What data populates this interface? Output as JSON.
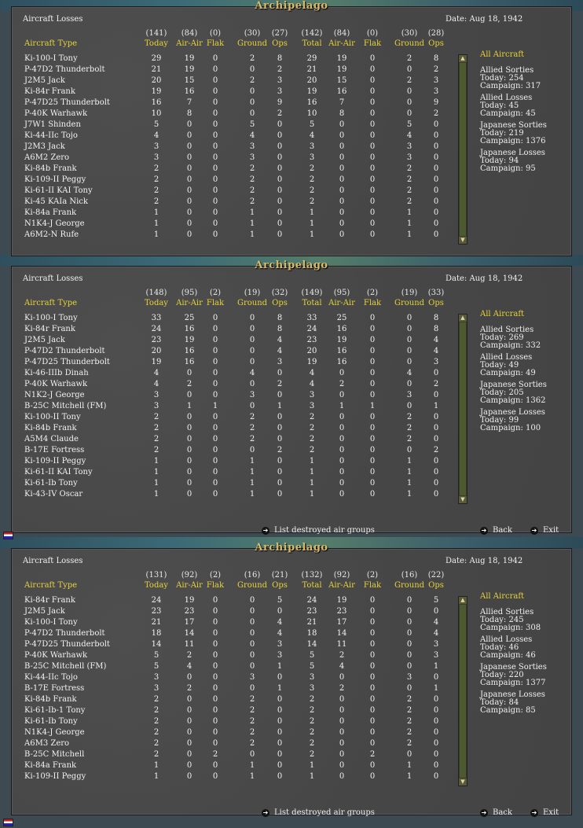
{
  "panels": [
    {
      "title": "Archipelago",
      "header": {
        "title": "Aircraft Losses",
        "date": "Date: Aug 18, 1942",
        "type_label": "Aircraft Type"
      },
      "totals": [
        "(141)",
        "(84)",
        "(0)",
        "(30)",
        "(27)",
        "(142)",
        "(84)",
        "(0)",
        "(30)",
        "(28)"
      ],
      "col_names": [
        "Today",
        "Air-Air",
        "Flak",
        "Ground",
        "Ops",
        "Total",
        "Air-Air",
        "Flak",
        "Ground",
        "Ops"
      ],
      "rows": [
        {
          "name": "Ki-100-I Tony",
          "v": [
            "29",
            "19",
            "0",
            "2",
            "8",
            "29",
            "19",
            "0",
            "2",
            "8"
          ]
        },
        {
          "name": "P-47D2 Thunderbolt",
          "v": [
            "21",
            "19",
            "0",
            "0",
            "2",
            "21",
            "19",
            "0",
            "0",
            "2"
          ]
        },
        {
          "name": "J2M5 Jack",
          "v": [
            "20",
            "15",
            "0",
            "2",
            "3",
            "20",
            "15",
            "0",
            "2",
            "3"
          ]
        },
        {
          "name": "Ki-84r Frank",
          "v": [
            "19",
            "16",
            "0",
            "0",
            "3",
            "19",
            "16",
            "0",
            "0",
            "3"
          ]
        },
        {
          "name": "P-47D25 Thunderbolt",
          "v": [
            "16",
            "7",
            "0",
            "0",
            "9",
            "16",
            "7",
            "0",
            "0",
            "9"
          ]
        },
        {
          "name": "P-40K Warhawk",
          "v": [
            "10",
            "8",
            "0",
            "0",
            "2",
            "10",
            "8",
            "0",
            "0",
            "2"
          ]
        },
        {
          "name": "J7W1 Shinden",
          "v": [
            "5",
            "0",
            "0",
            "5",
            "0",
            "5",
            "0",
            "0",
            "5",
            "0"
          ]
        },
        {
          "name": "Ki-44-IIc Tojo",
          "v": [
            "4",
            "0",
            "0",
            "4",
            "0",
            "4",
            "0",
            "0",
            "4",
            "0"
          ]
        },
        {
          "name": "J2M3 Jack",
          "v": [
            "3",
            "0",
            "0",
            "3",
            "0",
            "3",
            "0",
            "0",
            "3",
            "0"
          ]
        },
        {
          "name": "A6M2 Zero",
          "v": [
            "3",
            "0",
            "0",
            "3",
            "0",
            "3",
            "0",
            "0",
            "3",
            "0"
          ]
        },
        {
          "name": "Ki-84b Frank",
          "v": [
            "2",
            "0",
            "0",
            "2",
            "0",
            "2",
            "0",
            "0",
            "2",
            "0"
          ]
        },
        {
          "name": "Ki-109-II Peggy",
          "v": [
            "2",
            "0",
            "0",
            "2",
            "0",
            "2",
            "0",
            "0",
            "2",
            "0"
          ]
        },
        {
          "name": "Ki-61-II KAI Tony",
          "v": [
            "2",
            "0",
            "0",
            "2",
            "0",
            "2",
            "0",
            "0",
            "2",
            "0"
          ]
        },
        {
          "name": "Ki-45 KAIa Nick",
          "v": [
            "2",
            "0",
            "0",
            "2",
            "0",
            "2",
            "0",
            "0",
            "2",
            "0"
          ]
        },
        {
          "name": "Ki-84a Frank",
          "v": [
            "1",
            "0",
            "0",
            "1",
            "0",
            "1",
            "0",
            "0",
            "1",
            "0"
          ]
        },
        {
          "name": "N1K4-J George",
          "v": [
            "1",
            "0",
            "0",
            "1",
            "0",
            "1",
            "0",
            "0",
            "1",
            "0"
          ]
        },
        {
          "name": "A6M2-N Rufe",
          "v": [
            "1",
            "0",
            "0",
            "1",
            "0",
            "1",
            "0",
            "0",
            "1",
            "0"
          ]
        }
      ],
      "side": {
        "all": "All Aircraft",
        "allied_sorties": {
          "label": "Allied Sorties",
          "today": "Today:   254",
          "campaign": "Campaign: 317"
        },
        "allied_losses": {
          "label": "Allied Losses",
          "today": "Today:   45",
          "campaign": "Campaign: 45"
        },
        "japanese_sorties": {
          "label": "Japanese Sorties",
          "today": "Today:   219",
          "campaign": "Campaign: 1376"
        },
        "japanese_losses": {
          "label": "Japanese Losses",
          "today": "Today:   94",
          "campaign": "Campaign: 95"
        }
      },
      "footer": null
    },
    {
      "title": "Archipelago",
      "header": {
        "title": "Aircraft Losses",
        "date": "Date: Aug 18, 1942",
        "type_label": "Aircraft Type"
      },
      "totals": [
        "(148)",
        "(95)",
        "(2)",
        "(19)",
        "(32)",
        "(149)",
        "(95)",
        "(2)",
        "(19)",
        "(33)"
      ],
      "col_names": [
        "Today",
        "Air-Air",
        "Flak",
        "Ground",
        "Ops",
        "Total",
        "Air-Air",
        "Flak",
        "Ground",
        "Ops"
      ],
      "rows": [
        {
          "name": "Ki-100-I Tony",
          "v": [
            "33",
            "25",
            "0",
            "0",
            "8",
            "33",
            "25",
            "0",
            "0",
            "8"
          ]
        },
        {
          "name": "Ki-84r Frank",
          "v": [
            "24",
            "16",
            "0",
            "0",
            "8",
            "24",
            "16",
            "0",
            "0",
            "8"
          ]
        },
        {
          "name": "J2M5 Jack",
          "v": [
            "23",
            "19",
            "0",
            "0",
            "4",
            "23",
            "19",
            "0",
            "0",
            "4"
          ]
        },
        {
          "name": "P-47D2 Thunderbolt",
          "v": [
            "20",
            "16",
            "0",
            "0",
            "4",
            "20",
            "16",
            "0",
            "0",
            "4"
          ]
        },
        {
          "name": "P-47D25 Thunderbolt",
          "v": [
            "19",
            "16",
            "0",
            "0",
            "3",
            "19",
            "16",
            "0",
            "0",
            "3"
          ]
        },
        {
          "name": "Ki-46-IIIb Dinah",
          "v": [
            "4",
            "0",
            "0",
            "4",
            "0",
            "4",
            "0",
            "0",
            "4",
            "0"
          ]
        },
        {
          "name": "P-40K Warhawk",
          "v": [
            "4",
            "2",
            "0",
            "0",
            "2",
            "4",
            "2",
            "0",
            "0",
            "2"
          ]
        },
        {
          "name": "N1K2-J George",
          "v": [
            "3",
            "0",
            "0",
            "3",
            "0",
            "3",
            "0",
            "0",
            "3",
            "0"
          ]
        },
        {
          "name": "B-25C Mitchell (FM)",
          "v": [
            "3",
            "1",
            "1",
            "0",
            "1",
            "3",
            "1",
            "1",
            "0",
            "1"
          ]
        },
        {
          "name": "Ki-100-II Tony",
          "v": [
            "2",
            "0",
            "0",
            "2",
            "0",
            "2",
            "0",
            "0",
            "2",
            "0"
          ]
        },
        {
          "name": "Ki-84b Frank",
          "v": [
            "2",
            "0",
            "0",
            "2",
            "0",
            "2",
            "0",
            "0",
            "2",
            "0"
          ]
        },
        {
          "name": "A5M4 Claude",
          "v": [
            "2",
            "0",
            "0",
            "2",
            "0",
            "2",
            "0",
            "0",
            "2",
            "0"
          ]
        },
        {
          "name": "B-17E Fortress",
          "v": [
            "2",
            "0",
            "0",
            "0",
            "2",
            "2",
            "0",
            "0",
            "0",
            "2"
          ]
        },
        {
          "name": "Ki-109-II Peggy",
          "v": [
            "1",
            "0",
            "0",
            "1",
            "0",
            "1",
            "0",
            "0",
            "1",
            "0"
          ]
        },
        {
          "name": "Ki-61-II KAI Tony",
          "v": [
            "1",
            "0",
            "0",
            "1",
            "0",
            "1",
            "0",
            "0",
            "1",
            "0"
          ]
        },
        {
          "name": "Ki-61-Ib Tony",
          "v": [
            "1",
            "0",
            "0",
            "1",
            "0",
            "1",
            "0",
            "0",
            "1",
            "0"
          ]
        },
        {
          "name": "Ki-43-IV Oscar",
          "v": [
            "1",
            "0",
            "0",
            "1",
            "0",
            "1",
            "0",
            "0",
            "1",
            "0"
          ]
        }
      ],
      "side": {
        "all": "All Aircraft",
        "allied_sorties": {
          "label": "Allied Sorties",
          "today": "Today:   269",
          "campaign": "Campaign: 332"
        },
        "allied_losses": {
          "label": "Allied Losses",
          "today": "Today:   49",
          "campaign": "Campaign: 49"
        },
        "japanese_sorties": {
          "label": "Japanese Sorties",
          "today": "Today:   205",
          "campaign": "Campaign: 1362"
        },
        "japanese_losses": {
          "label": "Japanese Losses",
          "today": "Today:   99",
          "campaign": "Campaign: 100"
        }
      },
      "footer": {
        "list": "List destroyed air groups",
        "back": "Back",
        "exit": "Exit"
      }
    },
    {
      "title": "Archipelago",
      "header": {
        "title": "Aircraft Losses",
        "date": "Date: Aug 18, 1942",
        "type_label": "Aircraft Type"
      },
      "totals": [
        "(131)",
        "(92)",
        "(2)",
        "(16)",
        "(21)",
        "(132)",
        "(92)",
        "(2)",
        "(16)",
        "(22)"
      ],
      "col_names": [
        "Today",
        "Air-Air",
        "Flak",
        "Ground",
        "Ops",
        "Total",
        "Air-Air",
        "Flak",
        "Ground",
        "Ops"
      ],
      "rows": [
        {
          "name": "Ki-84r Frank",
          "v": [
            "24",
            "19",
            "0",
            "0",
            "5",
            "24",
            "19",
            "0",
            "0",
            "5"
          ]
        },
        {
          "name": "J2M5 Jack",
          "v": [
            "23",
            "23",
            "0",
            "0",
            "0",
            "23",
            "23",
            "0",
            "0",
            "0"
          ]
        },
        {
          "name": "Ki-100-I Tony",
          "v": [
            "21",
            "17",
            "0",
            "0",
            "4",
            "21",
            "17",
            "0",
            "0",
            "4"
          ]
        },
        {
          "name": "P-47D2 Thunderbolt",
          "v": [
            "18",
            "14",
            "0",
            "0",
            "4",
            "18",
            "14",
            "0",
            "0",
            "4"
          ]
        },
        {
          "name": "P-47D25 Thunderbolt",
          "v": [
            "14",
            "11",
            "0",
            "0",
            "3",
            "14",
            "11",
            "0",
            "0",
            "3"
          ]
        },
        {
          "name": "P-40K Warhawk",
          "v": [
            "5",
            "2",
            "0",
            "0",
            "3",
            "5",
            "2",
            "0",
            "0",
            "3"
          ]
        },
        {
          "name": "B-25C Mitchell (FM)",
          "v": [
            "5",
            "4",
            "0",
            "0",
            "1",
            "5",
            "4",
            "0",
            "0",
            "1"
          ]
        },
        {
          "name": "Ki-44-IIc Tojo",
          "v": [
            "3",
            "0",
            "0",
            "3",
            "0",
            "3",
            "0",
            "0",
            "3",
            "0"
          ]
        },
        {
          "name": "B-17E Fortress",
          "v": [
            "3",
            "2",
            "0",
            "0",
            "1",
            "3",
            "2",
            "0",
            "0",
            "1"
          ]
        },
        {
          "name": "Ki-84b Frank",
          "v": [
            "2",
            "0",
            "0",
            "2",
            "0",
            "2",
            "0",
            "0",
            "2",
            "0"
          ]
        },
        {
          "name": "Ki-61-Ib-1 Tony",
          "v": [
            "2",
            "0",
            "0",
            "2",
            "0",
            "2",
            "0",
            "0",
            "2",
            "0"
          ]
        },
        {
          "name": "Ki-61-Ib Tony",
          "v": [
            "2",
            "0",
            "0",
            "2",
            "0",
            "2",
            "0",
            "0",
            "2",
            "0"
          ]
        },
        {
          "name": "N1K4-J George",
          "v": [
            "2",
            "0",
            "0",
            "2",
            "0",
            "2",
            "0",
            "0",
            "2",
            "0"
          ]
        },
        {
          "name": "A6M3 Zero",
          "v": [
            "2",
            "0",
            "0",
            "2",
            "0",
            "2",
            "0",
            "0",
            "2",
            "0"
          ]
        },
        {
          "name": "B-25C Mitchell",
          "v": [
            "2",
            "0",
            "2",
            "0",
            "0",
            "2",
            "0",
            "2",
            "0",
            "0"
          ]
        },
        {
          "name": "Ki-84a Frank",
          "v": [
            "1",
            "0",
            "0",
            "1",
            "0",
            "1",
            "0",
            "0",
            "1",
            "0"
          ]
        },
        {
          "name": "Ki-109-II Peggy",
          "v": [
            "1",
            "0",
            "0",
            "1",
            "0",
            "1",
            "0",
            "0",
            "1",
            "0"
          ]
        }
      ],
      "side": {
        "all": "All Aircraft",
        "allied_sorties": {
          "label": "Allied Sorties",
          "today": "Today:   245",
          "campaign": "Campaign: 308"
        },
        "allied_losses": {
          "label": "Allied Losses",
          "today": "Today:   46",
          "campaign": "Campaign: 46"
        },
        "japanese_sorties": {
          "label": "Japanese Sorties",
          "today": "Today:   220",
          "campaign": "Campaign: 1377"
        },
        "japanese_losses": {
          "label": "Japanese Losses",
          "today": "Today:   84",
          "campaign": "Campaign: 85"
        }
      },
      "footer": {
        "list": "List destroyed air groups",
        "back": "Back",
        "exit": "Exit"
      }
    }
  ],
  "colors": {
    "accent_yellow": "#e6d23a",
    "title_gold": "#d8b96a",
    "panel_bg": "#4a4a4a"
  }
}
